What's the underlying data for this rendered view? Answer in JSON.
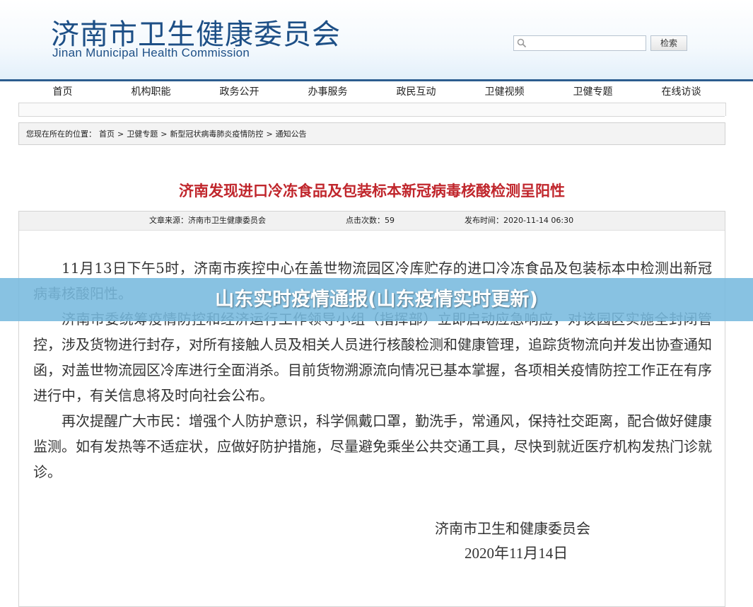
{
  "header": {
    "title": "济南市卫生健康委员会",
    "subtitle": "Jinan Municipal Health Commission",
    "search": {
      "placeholder": "",
      "button_label": "检索"
    }
  },
  "nav": {
    "items": [
      {
        "label": "首页"
      },
      {
        "label": "机构职能"
      },
      {
        "label": "政务公开"
      },
      {
        "label": "办事服务"
      },
      {
        "label": "政民互动"
      },
      {
        "label": "卫健视频"
      },
      {
        "label": "卫健专题"
      },
      {
        "label": "在线访谈"
      }
    ]
  },
  "breadcrumb": {
    "prefix": "您现在所在的位置：",
    "items": [
      "首页",
      "卫健专题",
      "新型冠状病毒肺炎疫情防控",
      "通知公告"
    ],
    "separator": ">"
  },
  "article": {
    "title": "济南发现进口冷冻食品及包装标本新冠病毒核酸检测呈阳性",
    "meta": {
      "source": "文章来源：济南市卫生健康委员会",
      "clicks": "点击次数：59",
      "published": "发布时间：2020-11-14 06:30"
    },
    "paragraphs": [
      "11月13日下午5时，济南市疾控中心在盖世物流园区冷库贮存的进口冷冻食品及包装标本中检测出新冠病毒核酸阳性。",
      "济南市委统筹疫情防控和经济运行工作领导小组（指挥部）立即启动应急响应，对该园区实施全封闭管控，涉及货物进行封存，对所有接触人员及相关人员进行核酸检测和健康管理，追踪货物流向并发出协查通知函，对盖世物流园区冷库进行全面消杀。目前货物溯源流向情况已基本掌握，各项相关疫情防控工作正在有序进行中，有关信息将及时向社会公布。",
      "再次提醒广大市民：增强个人防护意识，科学佩戴口罩，勤洗手，常通风，保持社交距离，配合做好健康监测。如有发热等不适症状，应做好防护措施，尽量避免乘坐公共交通工具，尽快到就近医疗机构发热门诊就诊。"
    ],
    "signature_org": "济南市卫生和健康委员会",
    "signature_date": "2020年11月14日"
  },
  "overlay": {
    "text": "山东实时疫情通报(山东疫情实时更新)"
  },
  "colors": {
    "brand": "#1d4f86",
    "title_red": "#c0262c",
    "overlay": "#78b9de"
  }
}
